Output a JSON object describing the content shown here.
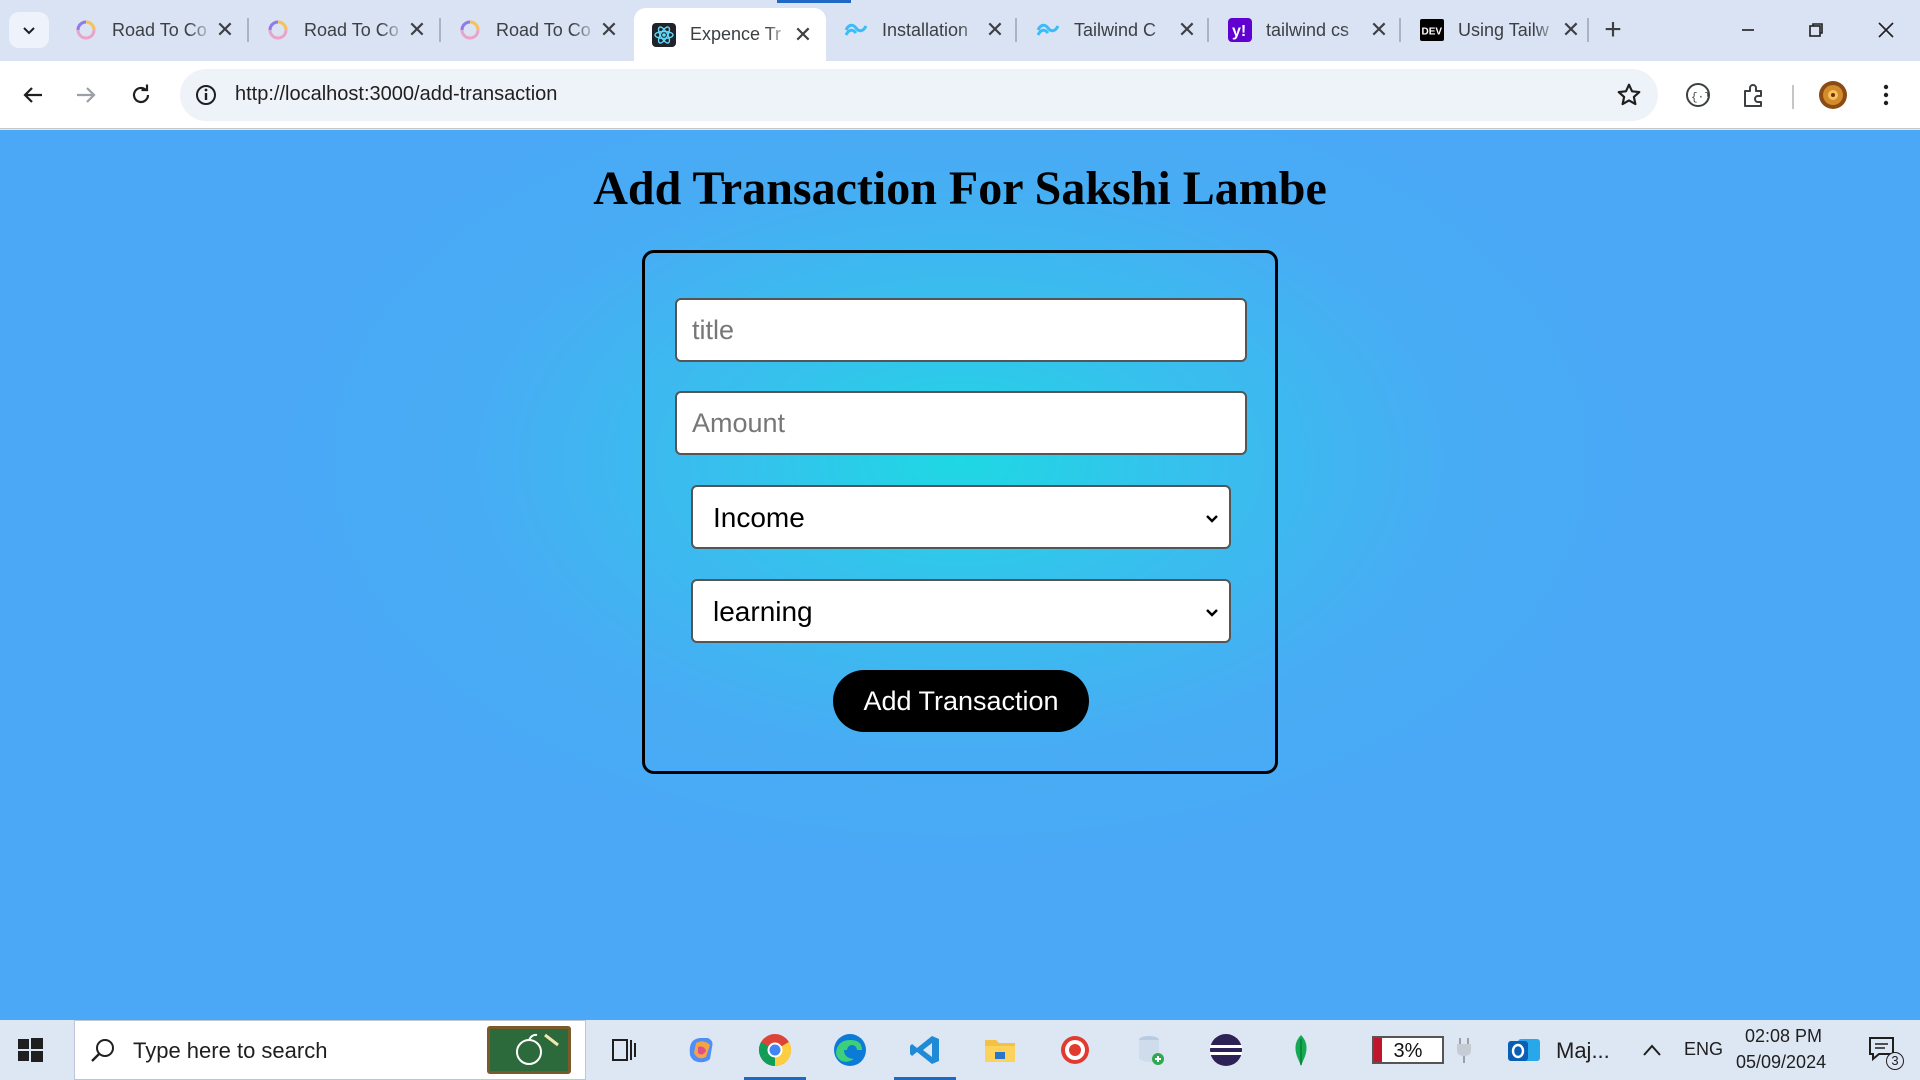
{
  "browser": {
    "tabs": [
      {
        "title": "Road To Co",
        "icon": "colorful-ring-icon",
        "active": false
      },
      {
        "title": "Road To Co",
        "icon": "colorful-ring-icon",
        "active": false
      },
      {
        "title": "Road To Co",
        "icon": "colorful-ring-icon",
        "active": false
      },
      {
        "title": "Expence Tr",
        "icon": "react-icon",
        "active": true
      },
      {
        "title": "Installation",
        "icon": "tailwind-icon",
        "active": false
      },
      {
        "title": "Tailwind C",
        "icon": "tailwind-icon",
        "active": false
      },
      {
        "title": "tailwind cs",
        "icon": "yahoo-icon",
        "active": false
      },
      {
        "title": "Using Tailw",
        "icon": "dev-icon",
        "active": false
      }
    ],
    "tab_close_glyph": "✕",
    "new_tab_glyph": "+",
    "url": "http://localhost:3000/add-transaction"
  },
  "page": {
    "title": "Add Transaction For Sakshi Lambe",
    "form": {
      "title_placeholder": "title",
      "amount_placeholder": "Amount",
      "type_select_value": "Income",
      "category_select_value": "learning",
      "submit_label": "Add Transaction"
    }
  },
  "taskbar": {
    "search_placeholder": "Type here to search",
    "battery_percent": "3%",
    "outlook_label": "Maj...",
    "language": "ENG",
    "time": "02:08 PM",
    "date": "05/09/2024",
    "notification_count": "3"
  },
  "colors": {
    "page_background": "#48acf4",
    "page_glow": "#1ed8e4",
    "button_background": "#000000",
    "button_text": "#ffffff"
  }
}
